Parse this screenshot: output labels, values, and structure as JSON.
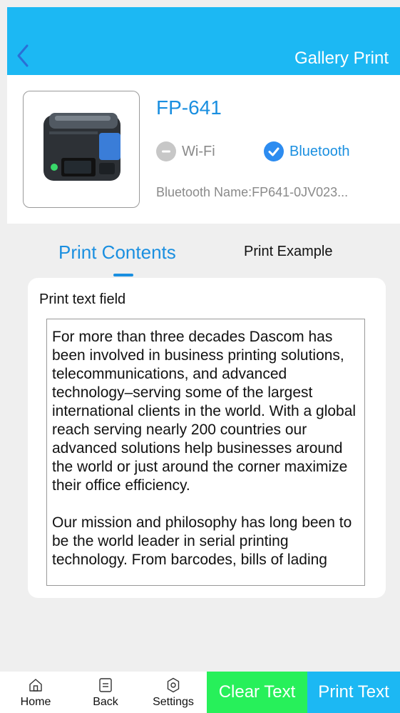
{
  "header": {
    "title": "Gallery Print",
    "accent_color": "#1cb8f3",
    "back_icon": "chevron-left-icon"
  },
  "printer": {
    "model": "FP-641",
    "image_icon": "printer-image",
    "wifi_label": "Wi-Fi",
    "wifi_selected": false,
    "bluetooth_label": "Bluetooth",
    "bluetooth_selected": true,
    "bluetooth_name": "Bluetooth Name:FP641-0JV023..."
  },
  "tabs": [
    {
      "label": "Print Contents",
      "active": true
    },
    {
      "label": "Print Example",
      "active": false
    }
  ],
  "content": {
    "field_label": "Print text field",
    "text": "For more than three decades Dascom has been involved in business printing solutions, telecommunications, and advanced technology–serving some of the largest international clients in the world. With a global reach serving nearly 200 countries our advanced solutions help businesses around the world or just around the corner maximize their office efficiency.\n\nOur mission and philosophy has long been to be the world leader in serial printing technology. From barcodes, bills of lading"
  },
  "bottom_nav": {
    "home_label": "Home",
    "back_label": "Back",
    "settings_label": "Settings"
  },
  "actions": {
    "clear_label": "Clear Text",
    "clear_color": "#27f05a",
    "print_label": "Print Text",
    "print_color": "#1cb8f3"
  }
}
